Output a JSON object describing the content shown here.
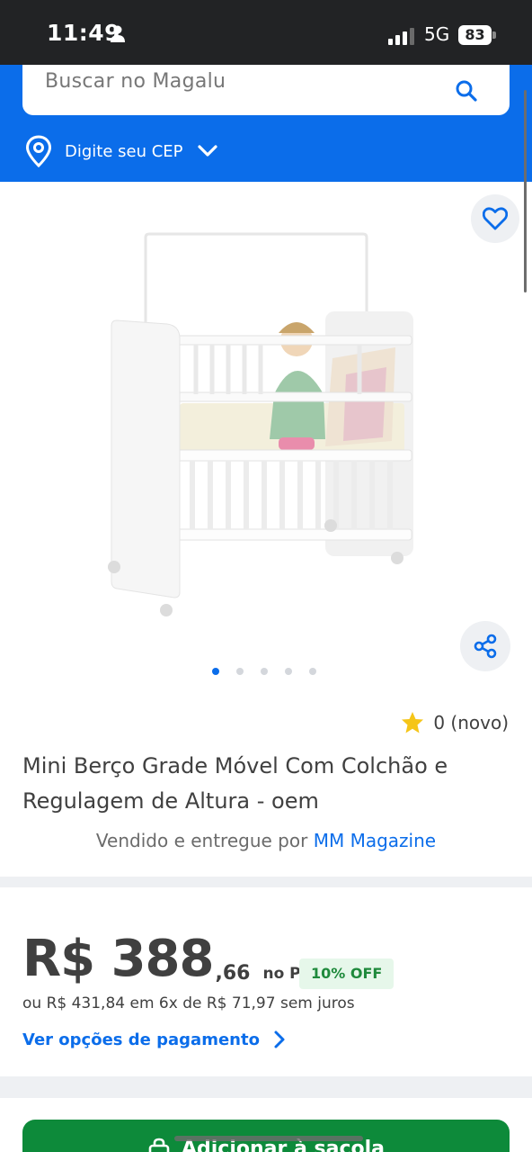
{
  "status_bar": {
    "time": "11:49",
    "network": "5G",
    "battery": "83"
  },
  "header": {
    "search_placeholder": "Buscar no Magalu",
    "cep_label": "Digite seu CEP"
  },
  "gallery": {
    "image_count": 5,
    "active_index": 0
  },
  "product": {
    "rating": "0 (novo)",
    "title": "Mini Berço Grade Móvel Com Colchão e Regulagem de Altura - oem",
    "seller_prefix": "Vendido e entregue por",
    "seller_name": "MM Magazine"
  },
  "price": {
    "main": "R$ 388",
    "cents": ",66",
    "pix_label": "no Pix",
    "discount": "10% OFF",
    "installments": "ou R$ 431,84 em 6x de R$ 71,97 sem juros",
    "payment_options_link": "Ver opções de pagamento"
  },
  "actions": {
    "add_to_bag": "Adicionar à sacola"
  },
  "colors": {
    "brand_blue": "#0b6dea",
    "buy_green": "#0d8a3a",
    "star_yellow": "#f5c518"
  },
  "icons": {
    "search": "search-icon",
    "location": "pin-icon",
    "favorite": "heart-icon",
    "share": "share-icon",
    "rating": "star-icon",
    "bag": "bag-icon"
  }
}
